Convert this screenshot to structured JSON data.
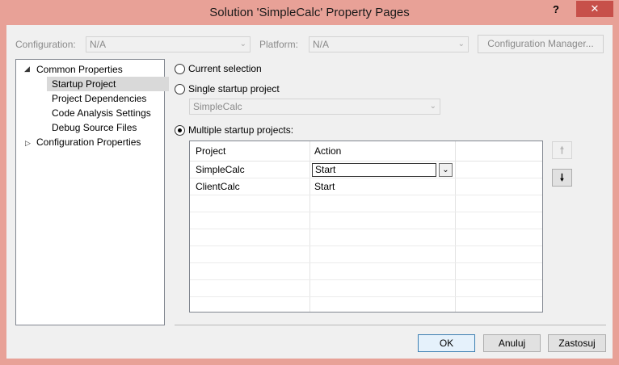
{
  "window": {
    "title": "Solution 'SimpleCalc' Property Pages",
    "help": "?",
    "close": "✕"
  },
  "toolbar": {
    "configuration_label": "Configuration:",
    "configuration_value": "N/A",
    "platform_label": "Platform:",
    "platform_value": "N/A",
    "config_manager_label": "Configuration Manager..."
  },
  "tree": {
    "items": [
      {
        "label": "Common Properties",
        "expanded": true
      },
      {
        "label": "Startup Project",
        "selected": true
      },
      {
        "label": "Project Dependencies"
      },
      {
        "label": "Code Analysis Settings"
      },
      {
        "label": "Debug Source Files"
      },
      {
        "label": "Configuration Properties",
        "expanded": false
      }
    ]
  },
  "options": {
    "current_selection": "Current selection",
    "single_startup": "Single startup project",
    "single_startup_value": "SimpleCalc",
    "multiple_startup": "Multiple startup projects:"
  },
  "grid": {
    "headers": [
      "Project",
      "Action"
    ],
    "rows": [
      {
        "project": "SimpleCalc",
        "action": "Start"
      },
      {
        "project": "ClientCalc",
        "action": "Start"
      }
    ]
  },
  "buttons": {
    "ok": "OK",
    "cancel": "Anuluj",
    "apply": "Zastosuj"
  },
  "icons": {
    "move_up": "arrow-up-icon",
    "move_down": "arrow-down-icon"
  }
}
